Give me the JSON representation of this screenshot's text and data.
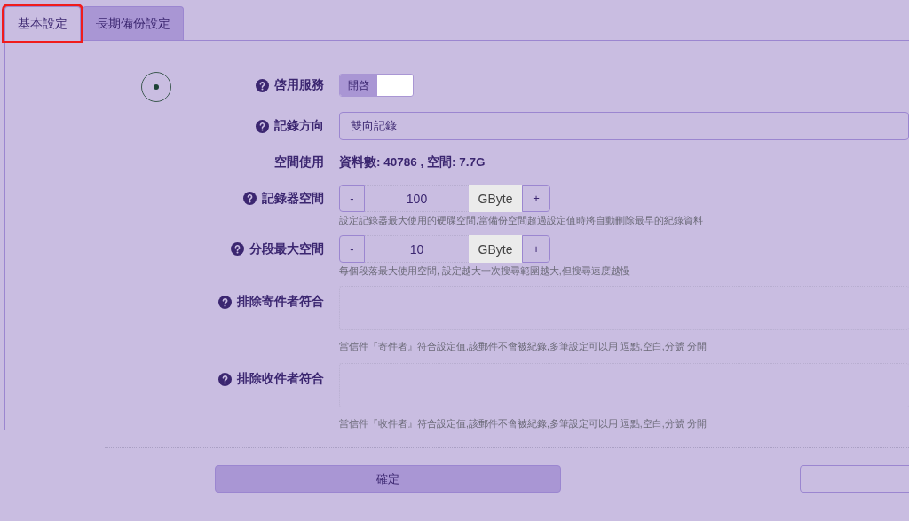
{
  "tabs": [
    {
      "label": "基本設定",
      "selected": true,
      "highlighted": true
    },
    {
      "label": "長期備份設定",
      "selected": false,
      "highlighted": false
    }
  ],
  "radio": {
    "selected": true
  },
  "form": [
    {
      "kind": "toggle",
      "help": true,
      "label": "啓用服務",
      "value_label": "開啓",
      "on": true
    },
    {
      "kind": "select",
      "help": true,
      "label": "記錄方向",
      "value": "雙向記錄"
    },
    {
      "kind": "text",
      "help": false,
      "label": "空間使用",
      "value": "資料數: 40786 , 空間: 7.7G"
    },
    {
      "kind": "stepper",
      "help": true,
      "label": "記錄器空間",
      "minus": "-",
      "value": "100",
      "unit": "GByte",
      "plus": "+",
      "hint": "設定記錄器最大使用的硬碟空間,當備份空間超過設定值時將自動刪除最早的紀錄資料"
    },
    {
      "kind": "stepper",
      "help": true,
      "label": "分段最大空間",
      "minus": "-",
      "value": "10",
      "unit": "GByte",
      "plus": "+",
      "hint": "每個段落最大使用空間, 設定越大一次搜尋範圍越大,但搜尋速度越慢"
    },
    {
      "kind": "textarea",
      "help": true,
      "label": "排除寄件者符合",
      "hint": "當信件『寄件者』符合設定值,該郵件不會被紀錄,多筆設定可以用 逗點,空白,分號 分開"
    },
    {
      "kind": "textarea",
      "help": true,
      "label": "排除收件者符合",
      "hint": "當信件『收件者』符合設定值,該郵件不會被紀錄,多筆設定可以用 逗點,空白,分號 分開"
    }
  ],
  "buttons": [
    {
      "kind": "primary",
      "label": "確定"
    },
    {
      "kind": "outline"
    }
  ]
}
